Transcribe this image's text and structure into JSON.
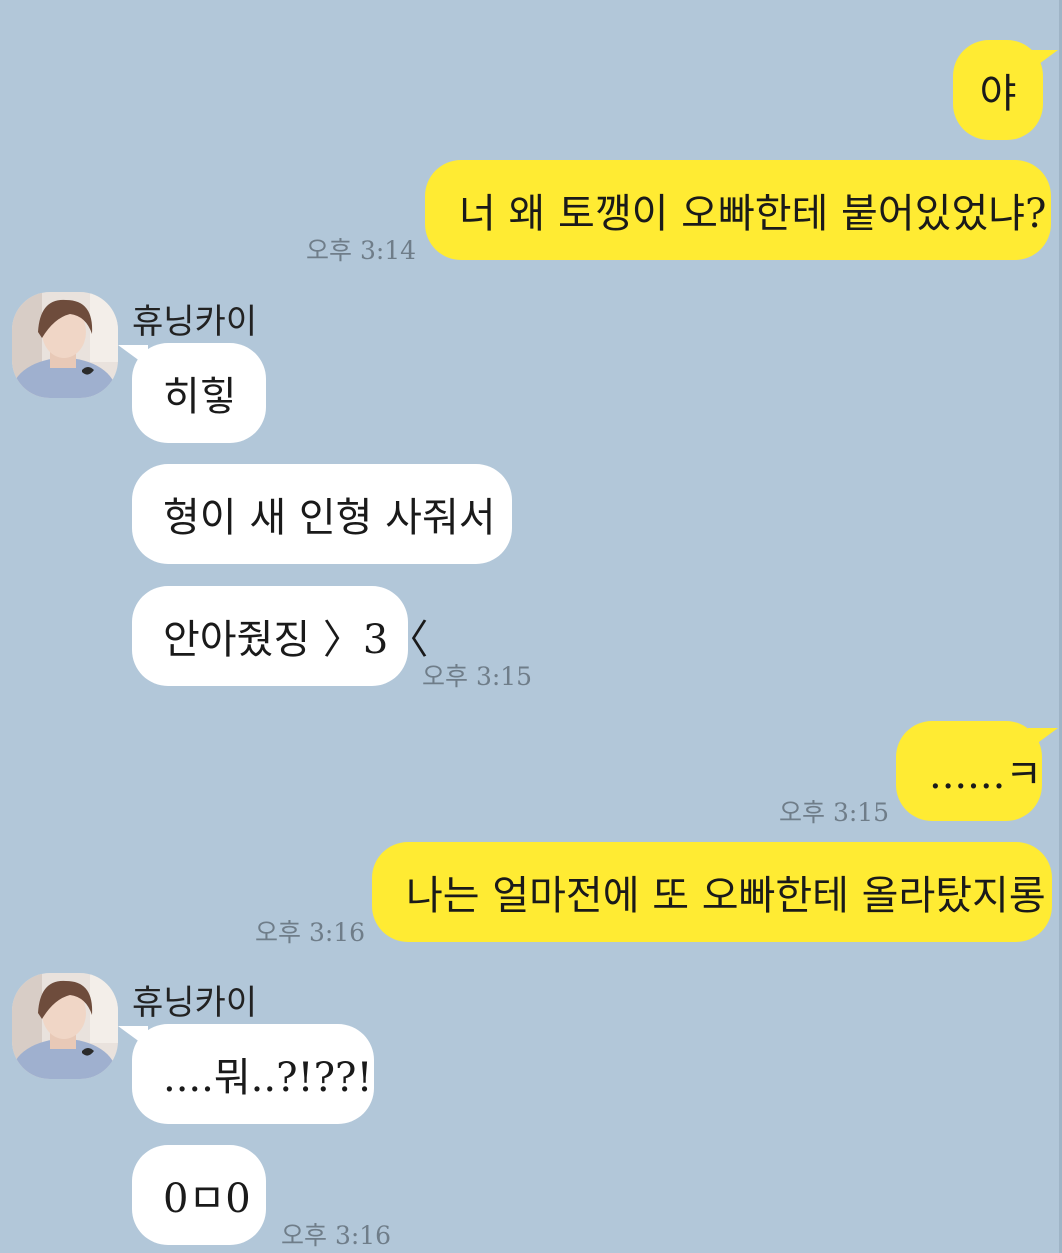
{
  "chat": {
    "contact_name": "휴닝카이",
    "messages": [
      {
        "from": "me",
        "text": "야"
      },
      {
        "from": "me",
        "text": "너 왜 토깽이 오빠한테 붙어있었냐?",
        "time": "오후 3:14"
      },
      {
        "from": "them",
        "text": "히힣"
      },
      {
        "from": "them",
        "text": "형이 새 인형 사줘서"
      },
      {
        "from": "them",
        "text": "안아줬징 〉3〈",
        "time": "오후 3:15"
      },
      {
        "from": "me",
        "text": "......ㅋ",
        "time": "오후 3:15"
      },
      {
        "from": "me",
        "text": "나는 얼마전에 또 오빠한테 올라탔지롱",
        "time": "오후 3:16"
      },
      {
        "from": "them",
        "text": "....뭐..?!??!"
      },
      {
        "from": "them",
        "text": "0ㅁ0",
        "time": "오후 3:16"
      }
    ]
  },
  "colors": {
    "background": "#b2c7d9",
    "my_bubble": "#ffeb33",
    "their_bubble": "#ffffff",
    "timestamp": "#6f7d89"
  },
  "icons": {
    "avatar": "profile-photo-avatar-icon"
  }
}
